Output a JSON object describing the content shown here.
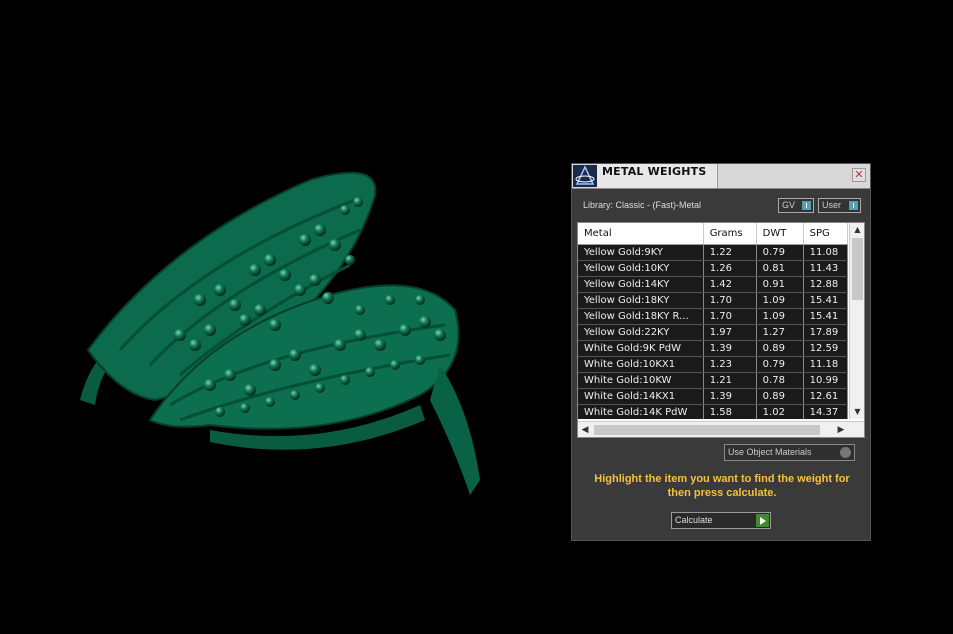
{
  "panel": {
    "title": "METAL WEIGHTS",
    "library_label": "Library: Classic - (Fast)-Metal",
    "toggles": {
      "gv": "GV",
      "user": "User"
    },
    "use_object_materials": "Use Object Materials",
    "instructions": "Highlight the item you want to find the weight for then press calculate.",
    "calculate": "Calculate"
  },
  "table": {
    "columns": [
      "Metal",
      "Grams",
      "DWT",
      "SPG"
    ],
    "rows": [
      [
        "Yellow Gold:9KY",
        "1.22",
        "0.79",
        "11.08"
      ],
      [
        "Yellow Gold:10KY",
        "1.26",
        "0.81",
        "11.43"
      ],
      [
        "Yellow Gold:14KY",
        "1.42",
        "0.91",
        "12.88"
      ],
      [
        "Yellow Gold:18KY",
        "1.70",
        "1.09",
        "15.41"
      ],
      [
        "Yellow Gold:18KY R...",
        "1.70",
        "1.09",
        "15.41"
      ],
      [
        "Yellow Gold:22KY",
        "1.97",
        "1.27",
        "17.89"
      ],
      [
        "White Gold:9K PdW",
        "1.39",
        "0.89",
        "12.59"
      ],
      [
        "White Gold:10KX1",
        "1.23",
        "0.79",
        "11.18"
      ],
      [
        "White Gold:10KW",
        "1.21",
        "0.78",
        "10.99"
      ],
      [
        "White Gold:14KX1",
        "1.39",
        "0.89",
        "12.61"
      ],
      [
        "White Gold:14K PdW",
        "1.58",
        "1.02",
        "14.37"
      ]
    ]
  },
  "colors": {
    "ring": "#0b6b4c",
    "instructions": "#f5c23a",
    "accent": "#5a9eb5"
  }
}
